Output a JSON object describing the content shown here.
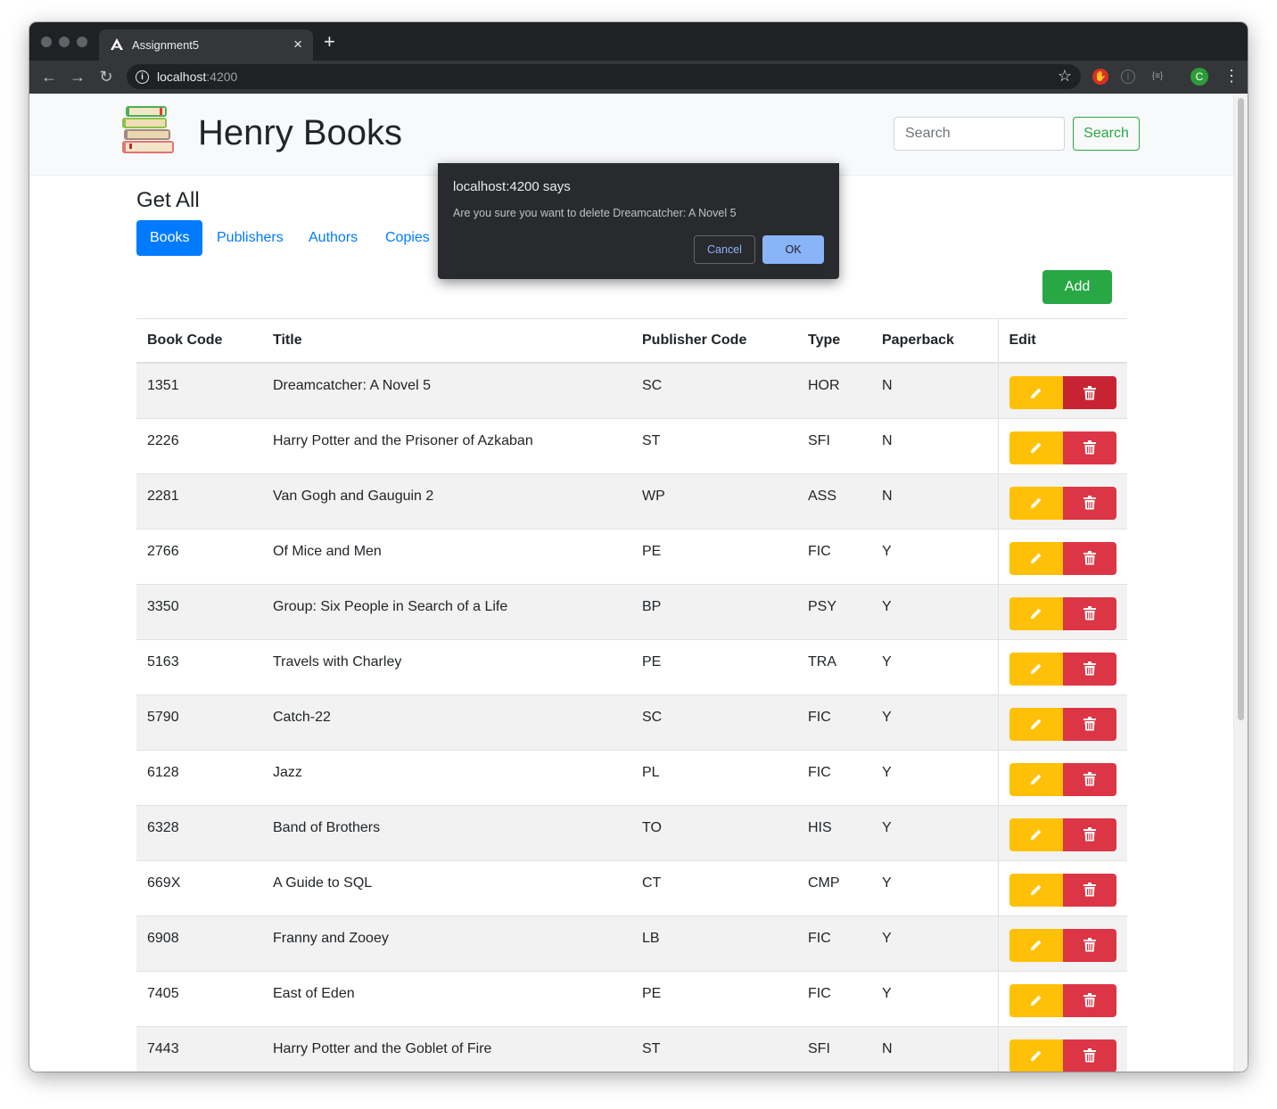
{
  "browser": {
    "tab_title": "Assignment5",
    "tab_close": "×",
    "new_tab": "+",
    "url_host": "localhost",
    "url_port": ":4200"
  },
  "navbar": {
    "brand": "Henry Books",
    "search_placeholder": "Search",
    "search_button": "Search"
  },
  "page": {
    "heading": "Get All",
    "tabs": [
      "Books",
      "Publishers",
      "Authors",
      "Copies"
    ],
    "active_tab": "Books",
    "add_button": "Add"
  },
  "table": {
    "columns": [
      "Book Code",
      "Title",
      "Publisher Code",
      "Type",
      "Paperback",
      "Edit"
    ],
    "rows": [
      {
        "code": "1351",
        "title": "Dreamcatcher: A Novel 5",
        "publisher": "SC",
        "type": "HOR",
        "paperback": "N"
      },
      {
        "code": "2226",
        "title": "Harry Potter and the Prisoner of Azkaban",
        "publisher": "ST",
        "type": "SFI",
        "paperback": "N"
      },
      {
        "code": "2281",
        "title": "Van Gogh and Gauguin 2",
        "publisher": "WP",
        "type": "ASS",
        "paperback": "N"
      },
      {
        "code": "2766",
        "title": "Of Mice and Men",
        "publisher": "PE",
        "type": "FIC",
        "paperback": "Y"
      },
      {
        "code": "3350",
        "title": "Group: Six People in Search of a Life",
        "publisher": "BP",
        "type": "PSY",
        "paperback": "Y"
      },
      {
        "code": "5163",
        "title": "Travels with Charley",
        "publisher": "PE",
        "type": "TRA",
        "paperback": "Y"
      },
      {
        "code": "5790",
        "title": "Catch-22",
        "publisher": "SC",
        "type": "FIC",
        "paperback": "Y"
      },
      {
        "code": "6128",
        "title": "Jazz",
        "publisher": "PL",
        "type": "FIC",
        "paperback": "Y"
      },
      {
        "code": "6328",
        "title": "Band of Brothers",
        "publisher": "TO",
        "type": "HIS",
        "paperback": "Y"
      },
      {
        "code": "669X",
        "title": "A Guide to SQL",
        "publisher": "CT",
        "type": "CMP",
        "paperback": "Y"
      },
      {
        "code": "6908",
        "title": "Franny and Zooey",
        "publisher": "LB",
        "type": "FIC",
        "paperback": "Y"
      },
      {
        "code": "7405",
        "title": "East of Eden",
        "publisher": "PE",
        "type": "FIC",
        "paperback": "Y"
      },
      {
        "code": "7443",
        "title": "Harry Potter and the Goblet of Fire",
        "publisher": "ST",
        "type": "SFI",
        "paperback": "N"
      }
    ]
  },
  "dialog": {
    "title": "localhost:4200 says",
    "message": "Are you sure you want to delete Dreamcatcher: A Novel 5",
    "cancel": "Cancel",
    "ok": "OK"
  },
  "icons": {
    "edit": "pencil-icon",
    "delete": "trash-icon"
  },
  "colors": {
    "primary": "#007bff",
    "success": "#28a745",
    "warning": "#ffc107",
    "danger": "#dc3545"
  }
}
